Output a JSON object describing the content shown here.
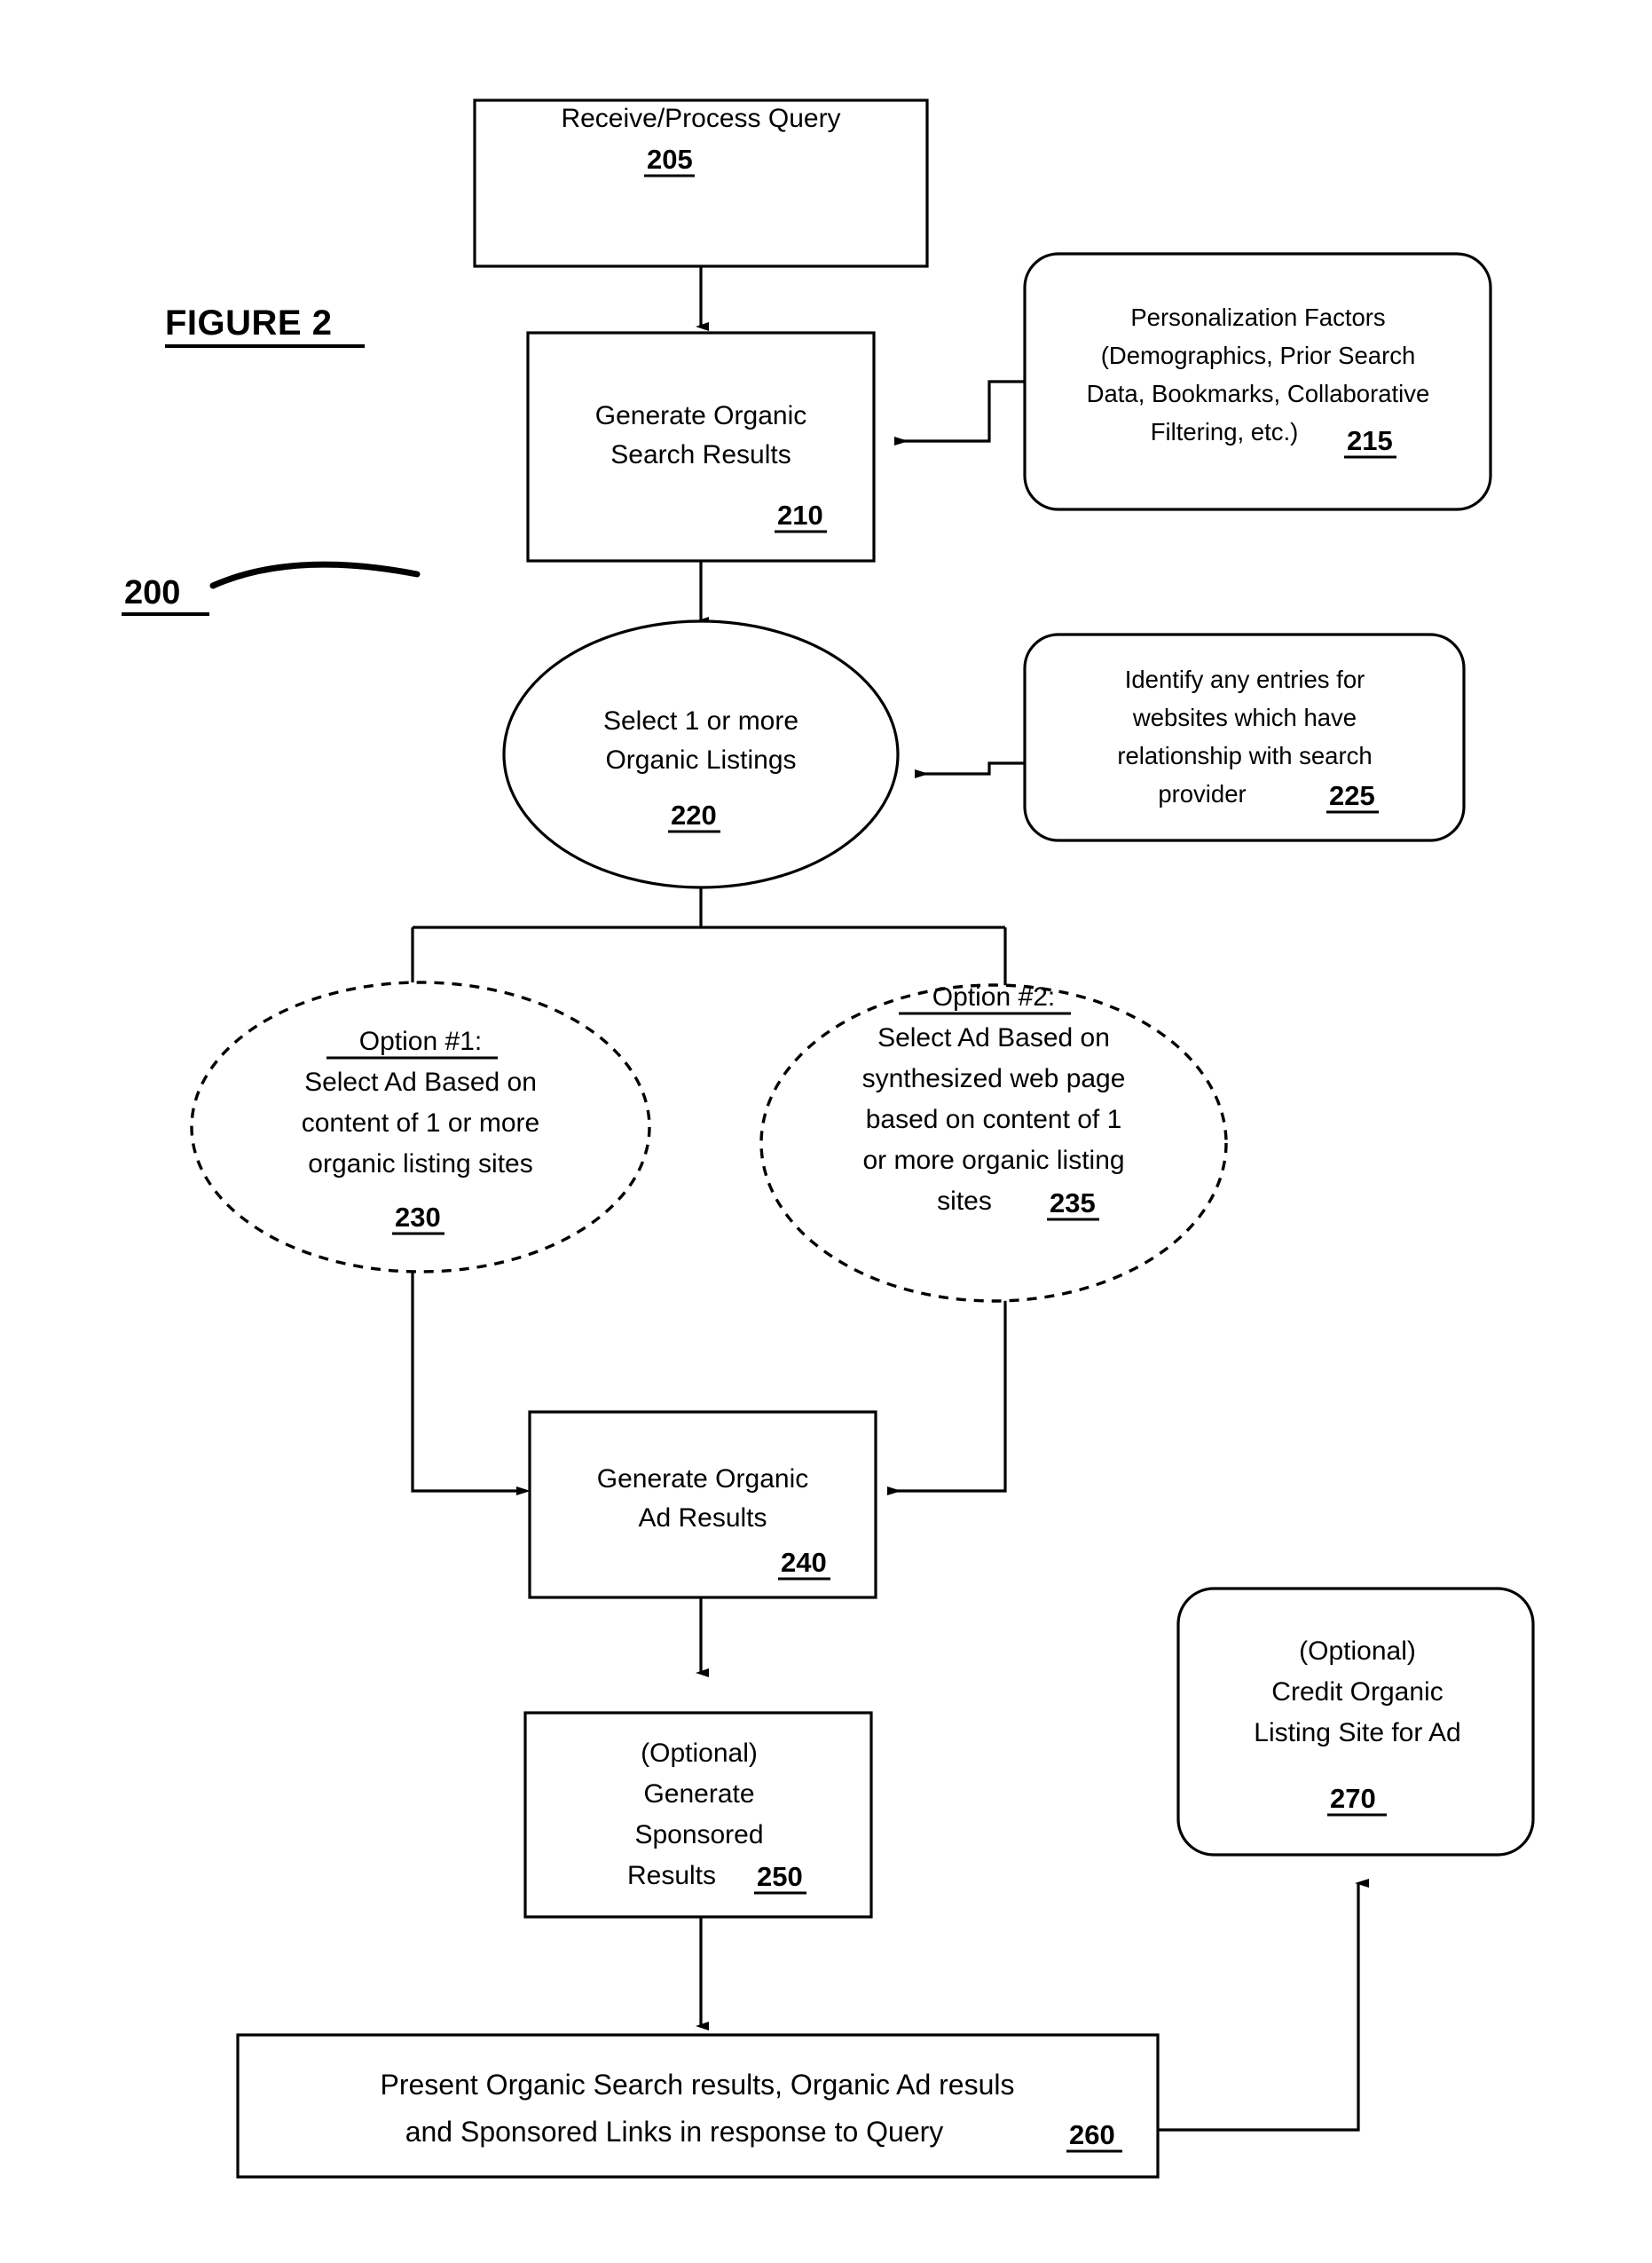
{
  "figure": {
    "label": "FIGURE 2",
    "process_ref": "200"
  },
  "nodes": {
    "receive_query": {
      "shape": "rectangle",
      "lines": [
        "Receive/Process Query"
      ],
      "ref": "205"
    },
    "generate_organic_search": {
      "shape": "rectangle",
      "lines": [
        "Generate Organic",
        "Search Results"
      ],
      "ref": "210"
    },
    "personalization_factors": {
      "shape": "rounded-rectangle",
      "lines": [
        "Personalization Factors",
        "(Demographics, Prior Search",
        "Data, Bookmarks, Collaborative",
        "Filtering, etc.)"
      ],
      "ref": "215"
    },
    "select_organic_listings": {
      "shape": "ellipse",
      "lines": [
        "Select 1 or more",
        "Organic Listings"
      ],
      "ref": "220"
    },
    "identify_entries": {
      "shape": "rounded-rectangle",
      "lines": [
        "Identify any entries for",
        "websites which have",
        "relationship with search",
        "provider"
      ],
      "ref": "225"
    },
    "option_1": {
      "shape": "dashed-ellipse",
      "heading": "Option #1:",
      "lines": [
        "Select Ad Based on",
        "content of 1 or more",
        "organic listing sites"
      ],
      "ref": "230"
    },
    "option_2": {
      "shape": "dashed-ellipse",
      "heading": "Option #2:",
      "lines": [
        "Select Ad Based on",
        "synthesized web page",
        "based on content of 1",
        "or more organic listing",
        "sites"
      ],
      "ref": "235"
    },
    "generate_ad_results": {
      "shape": "rectangle",
      "lines": [
        "Generate Organic",
        "Ad Results"
      ],
      "ref": "240"
    },
    "generate_sponsored_results": {
      "shape": "rectangle",
      "lines": [
        "(Optional)",
        "Generate",
        "Sponsored",
        "Results"
      ],
      "ref": "250"
    },
    "credit_listing_site": {
      "shape": "rounded-rectangle",
      "lines": [
        "(Optional)",
        "Credit Organic",
        "Listing Site for Ad"
      ],
      "ref": "270"
    },
    "present_results": {
      "shape": "rectangle",
      "lines": [
        "Present Organic Search results, Organic Ad resuls",
        "and Sponsored Links in response to Query"
      ],
      "ref": "260"
    }
  },
  "colors": {
    "stroke": "#000000",
    "fill": "#ffffff",
    "text": "#000000"
  }
}
